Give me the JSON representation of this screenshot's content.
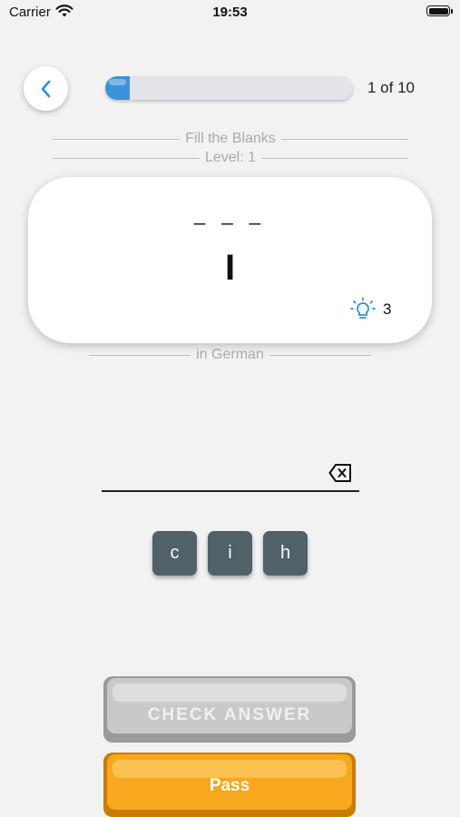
{
  "status_bar": {
    "carrier": "Carrier",
    "time": "19:53"
  },
  "header": {
    "progress_fraction": 0.1,
    "counter": "1 of 10"
  },
  "exercise": {
    "mode": "Fill the Blanks",
    "level": "Level: 1",
    "blanks": "_ _ _",
    "word": "I",
    "hint_count": "3",
    "language_note": "in German"
  },
  "answer": {
    "value": ""
  },
  "letter_keys": [
    "c",
    "i",
    "h"
  ],
  "buttons": {
    "check": "CHECK ANSWER",
    "pass": "Pass"
  },
  "colors": {
    "accent_blue": "#3b93d7",
    "key_bg": "#506168",
    "pass_orange": "#f7a81e",
    "check_disabled": "#c9c9c9"
  },
  "icons": {
    "back": "chevron-left-icon",
    "hint": "lightbulb-icon",
    "backspace": "backspace-icon",
    "wifi": "wifi-icon",
    "battery": "battery-icon"
  }
}
